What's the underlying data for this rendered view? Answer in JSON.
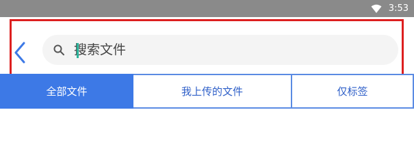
{
  "status_bar": {
    "time": "3:53",
    "wifi_icon": "wifi-icon"
  },
  "search": {
    "back_icon": "chevron-left-icon",
    "search_icon": "search-icon",
    "placeholder": "搜索文件",
    "value": ""
  },
  "tabs": [
    {
      "label": "全部文件",
      "active": true
    },
    {
      "label": "我上传的文件",
      "active": false
    },
    {
      "label": "仅标签",
      "active": false
    }
  ],
  "colors": {
    "accent": "#3d79e6",
    "highlight": "#dd1f1f",
    "status_bar": "#8a8a8a",
    "caret": "#2bb39a"
  }
}
